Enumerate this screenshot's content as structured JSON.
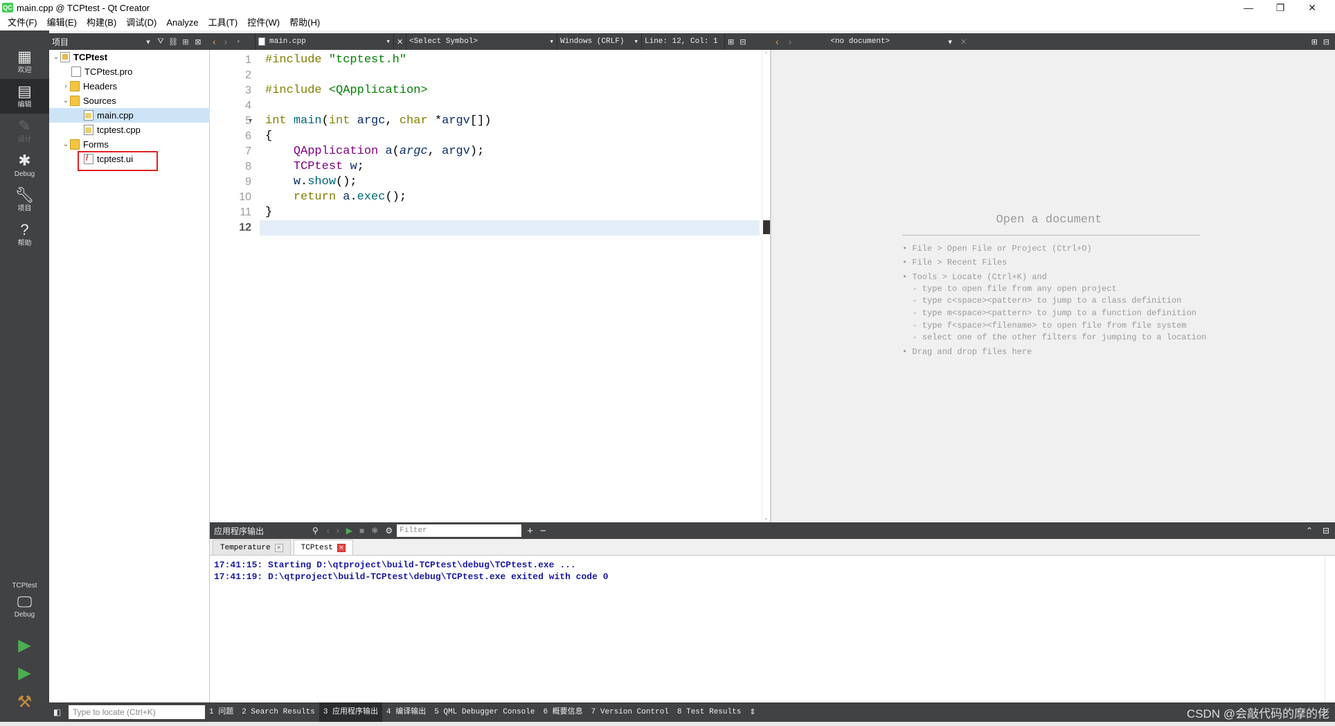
{
  "window": {
    "title": "main.cpp @ TCPtest - Qt Creator",
    "app_icon": "QC",
    "minimize": "—",
    "restore": "❐",
    "close": "✕"
  },
  "menu": [
    "文件(F)",
    "编辑(E)",
    "构建(B)",
    "调试(D)",
    "Analyze",
    "工具(T)",
    "控件(W)",
    "帮助(H)"
  ],
  "modes": [
    {
      "label": "欢迎",
      "icon": "grid-icon"
    },
    {
      "label": "编辑",
      "icon": "edit-icon"
    },
    {
      "label": "设计",
      "icon": "pencil-icon"
    },
    {
      "label": "Debug",
      "icon": "bug-icon"
    },
    {
      "label": "项目",
      "icon": "wrench-icon"
    },
    {
      "label": "帮助",
      "icon": "help-icon"
    }
  ],
  "target": {
    "project": "TCPtest",
    "config": "Debug"
  },
  "project_panel": {
    "title": "项目",
    "tree": [
      {
        "label": "TCPtest",
        "type": "proj",
        "bold": true
      },
      {
        "label": "TCPtest.pro",
        "type": "file"
      },
      {
        "label": "Headers",
        "type": "folder"
      },
      {
        "label": "Sources",
        "type": "folder"
      },
      {
        "label": "main.cpp",
        "type": "cpp"
      },
      {
        "label": "tcptest.cpp",
        "type": "cpp"
      },
      {
        "label": "Forms",
        "type": "folder"
      },
      {
        "label": "tcptest.ui",
        "type": "ui"
      }
    ]
  },
  "editor_toolbar": {
    "file": "main.cpp",
    "symbol": "<Select Symbol>",
    "line_ending": "Windows (CRLF)",
    "position": "Line: 12, Col: 1"
  },
  "right_toolbar": {
    "doc": "<no document>"
  },
  "code": {
    "line_numbers": [
      "1",
      "2",
      "3",
      "4",
      "5",
      "6",
      "7",
      "8",
      "9",
      "10",
      "11",
      "12"
    ],
    "current_line": 12
  },
  "open_document": {
    "title": "Open a document",
    "hints": [
      "• File > Open File or Project (Ctrl+O)",
      "• File > Recent Files",
      "• Tools > Locate (Ctrl+K) and",
      "  - type to open file from any open project",
      "  - type c<space><pattern> to jump to a class definition",
      "  - type m<space><pattern> to jump to a function definition",
      "  - type f<space><filename> to open file from file system",
      "  - select one of the other filters for jumping to a location",
      "• Drag and drop files here"
    ]
  },
  "output": {
    "title": "应用程序输出",
    "filter_placeholder": "Filter",
    "tabs": [
      "Temperature",
      "TCPtest"
    ],
    "lines": [
      "17:41:15: Starting D:\\qtproject\\build-TCPtest\\debug\\TCPtest.exe ...",
      "17:41:19: D:\\qtproject\\build-TCPtest\\debug\\TCPtest.exe exited with code 0"
    ]
  },
  "statusbar": {
    "locator_placeholder": "Type to locate (Ctrl+K)",
    "tabs": [
      "1  问题",
      "2  Search Results",
      "3  应用程序输出",
      "4  编译输出",
      "5  QML Debugger Console",
      "6  概要信息",
      "7  Version Control",
      "8  Test Results"
    ]
  },
  "watermark": "CSDN @会敲代码的摩的佬"
}
